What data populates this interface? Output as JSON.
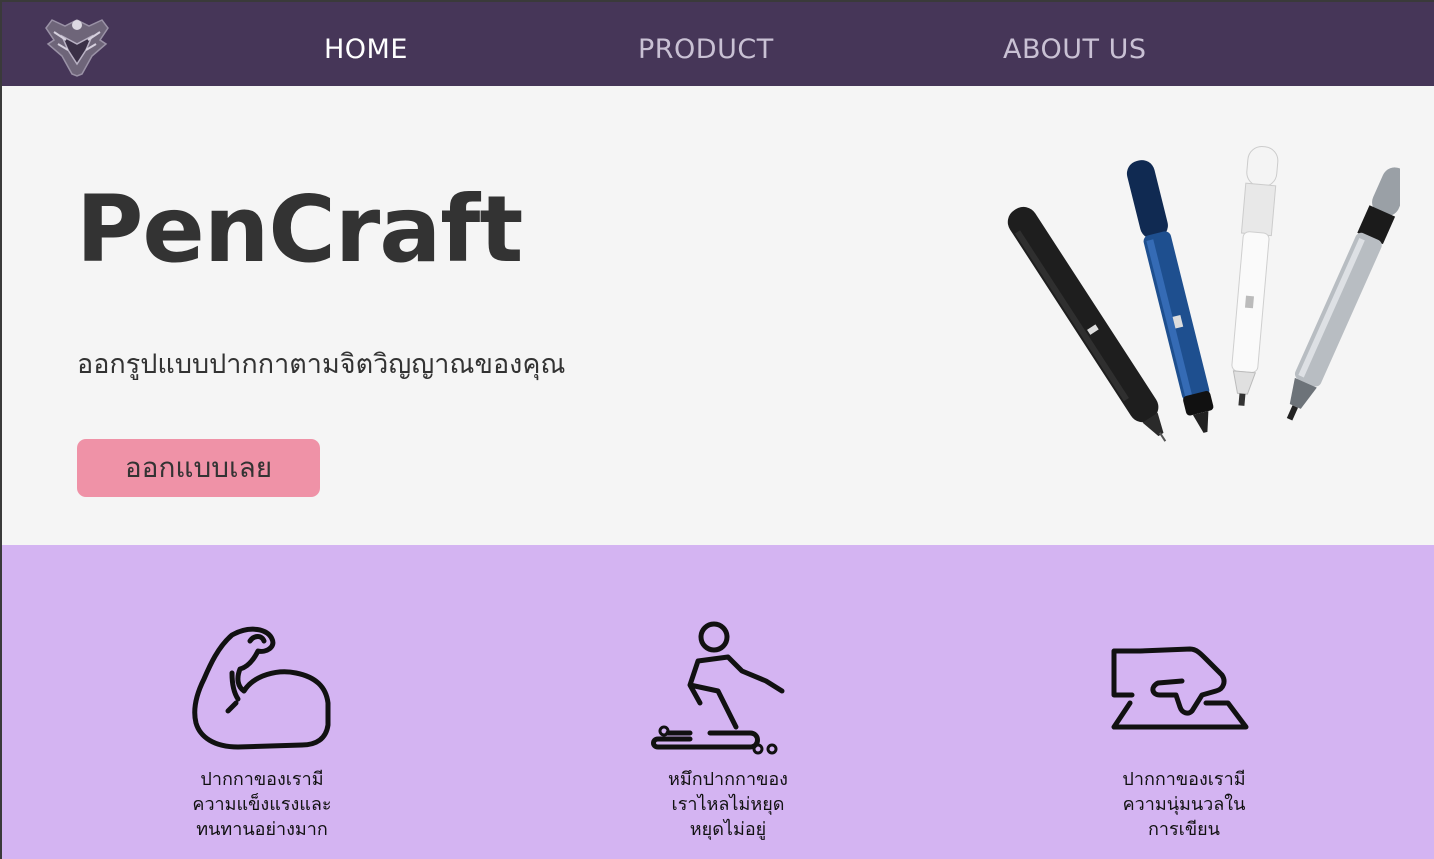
{
  "nav": {
    "logo": "pencraft-logo",
    "home": "HOME",
    "product": "PRODUCT",
    "about": "ABOUT US"
  },
  "hero": {
    "title": "PenCraft",
    "subtitle": "ออกรูปแบบปากกาตามจิตวิญญาณของคุณ",
    "cta_label": "ออกแบบเลย",
    "image": "pens-image"
  },
  "features": [
    {
      "icon": "muscle-arm-icon",
      "text": "ปากกาของเรามี\nความแข็งแรงและ\nทนทานอย่างมาก"
    },
    {
      "icon": "slipping-person-icon",
      "text": "หมึกปากกาของ\nเราไหลไม่หยุด\nหยุดไม่อยู่"
    },
    {
      "icon": "hand-writing-icon",
      "text": "ปากกาของเรามี\nความนุ่มนวลใน\nการเขียน"
    }
  ],
  "colors": {
    "nav_bg": "#463658",
    "hero_bg": "#f5f5f5",
    "cta_bg": "#ef92a7",
    "features_bg": "#d4b4f2"
  }
}
